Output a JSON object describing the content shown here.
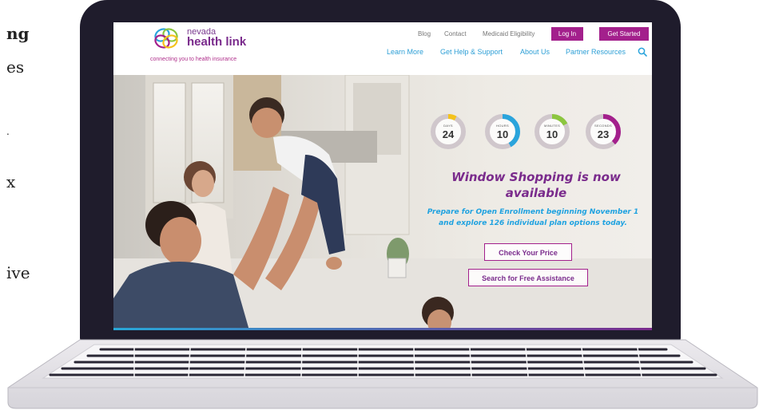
{
  "article": {
    "lines": [
      "ng",
      "es",
      "x",
      "ive"
    ]
  },
  "site": {
    "logo_small": "nevada",
    "logo_big": "health link",
    "tagline": "connecting you to health insurance"
  },
  "utility_nav": {
    "blog": "Blog",
    "contact": "Contact",
    "medicaid": "Medicaid Eligibility",
    "login": "Log In",
    "get_started": "Get Started"
  },
  "main_nav": {
    "items": [
      "Learn More",
      "Get Help & Support",
      "About Us",
      "Partner Resources"
    ]
  },
  "countdown": [
    {
      "unit": "DAYS",
      "value": "24",
      "color": "#f4c21b",
      "progress": 0.08
    },
    {
      "unit": "HOURS",
      "value": "10",
      "color": "#2aa4dc",
      "progress": 0.42
    },
    {
      "unit": "MINUTES",
      "value": "10",
      "color": "#8cc63f",
      "progress": 0.17
    },
    {
      "unit": "SECONDS",
      "value": "23",
      "color": "#a3208c",
      "progress": 0.38
    }
  ],
  "hero": {
    "headline_1": "Window Shopping is now",
    "headline_2": "available",
    "sub_1": "Prepare for Open Enrollment beginning November 1",
    "sub_2": "and explore 126 individual plan options today.",
    "cta_price": "Check Your Price",
    "cta_assist": "Search for Free Assistance"
  },
  "colors": {
    "brand_purple": "#a3208c",
    "brand_blue": "#2aa4dc",
    "laptop": "#1f1c2c"
  }
}
